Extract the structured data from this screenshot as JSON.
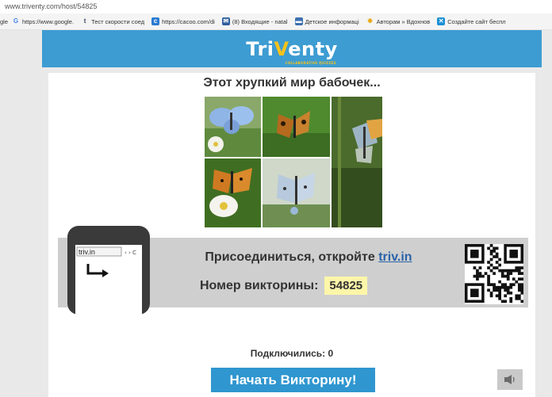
{
  "browser": {
    "url": "www.triventy.com/host/54825",
    "bookmarks": [
      {
        "icon": "google-icon",
        "label": "https://www.google."
      },
      {
        "icon": "tumblr-icon",
        "label": "Тест скорости соед"
      },
      {
        "icon": "cacoo-icon",
        "label": "https://cacoo.com/di"
      },
      {
        "icon": "mail-icon",
        "label": "(8) Входящие - natal"
      },
      {
        "icon": "doc-icon",
        "label": "Детское информаці"
      },
      {
        "icon": "star-icon",
        "label": "Авторам » Вдохнов"
      },
      {
        "icon": "site-icon",
        "label": "Создайте сайт беспл"
      }
    ],
    "bookmark_prefix": "gle"
  },
  "header": {
    "logo_part1": "Tri",
    "logo_v": "V",
    "logo_part2": "enty",
    "tagline": "COLLABORATIVE QUIZZES",
    "color": "#3d9cd2"
  },
  "quiz": {
    "title": "Этот хрупкий мир бабочек..."
  },
  "join": {
    "prefix": "Присоединиться, откройте",
    "link": "triv.in",
    "number_label": "Номер викторины:",
    "number": "54825",
    "phone_url": "triv.in"
  },
  "status": {
    "connected": "Подключились: 0"
  },
  "actions": {
    "start_label": "Начать Викторину!",
    "sound_icon": "speaker-icon"
  }
}
